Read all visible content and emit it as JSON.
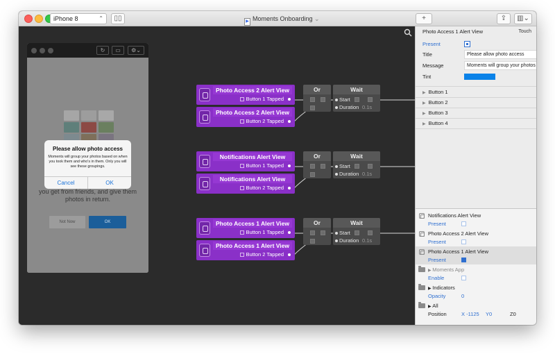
{
  "toolbar": {
    "device": "iPhone 8",
    "document_title": "Moments Onboarding",
    "add_label": "+"
  },
  "preview": {
    "alert": {
      "title": "Please allow photo access",
      "message": "Moments will group your photos based on when you took them and who's in them. Only you will see these groupings.",
      "cancel_label": "Cancel",
      "ok_label": "OK"
    },
    "background_lines": [
      "you get from friends, and give them",
      "photos in return."
    ],
    "not_now_label": "Not Now",
    "ok_label": "OK"
  },
  "canvas": {
    "groups": [
      {
        "blocks": [
          {
            "title": "Photo Access 2 Alert View",
            "port": "Button 1 Tapped"
          },
          {
            "title": "Photo Access 2 Alert View",
            "port": "Button 2 Tapped"
          }
        ],
        "or_label": "Or",
        "wait": {
          "title": "Wait",
          "start_label": "Start",
          "duration_label": "Duration",
          "duration_value": "0.1s"
        }
      },
      {
        "blocks": [
          {
            "title": "Notifications Alert View",
            "port": "Button 1 Tapped"
          },
          {
            "title": "Notifications Alert View",
            "port": "Button 2 Tapped"
          }
        ],
        "or_label": "Or",
        "wait": {
          "title": "Wait",
          "start_label": "Start",
          "duration_label": "Duration",
          "duration_value": "0.1s"
        }
      },
      {
        "blocks": [
          {
            "title": "Photo Access 1 Alert View",
            "port": "Button 1 Tapped"
          },
          {
            "title": "Photo Access 1 Alert View",
            "port": "Button 2 Tapped"
          }
        ],
        "or_label": "Or",
        "wait": {
          "title": "Wait",
          "start_label": "Start",
          "duration_label": "Duration",
          "duration_value": "0.1s"
        }
      }
    ]
  },
  "inspector": {
    "header": "Photo Access 1 Alert View",
    "touch_label": "Touch",
    "present_label": "Present",
    "title_label": "Title",
    "title_value": "Please allow photo access",
    "message_label": "Message",
    "message_value": "Moments will group your photos based on when",
    "tint_label": "Tint",
    "tint_color": "#0a82e8",
    "buttons": [
      "Button 1",
      "Button 2",
      "Button 3",
      "Button 4"
    ]
  },
  "layers": [
    {
      "name": "Notifications Alert View",
      "prop": "Present",
      "checked": false
    },
    {
      "name": "Photo Access 2 Alert View",
      "prop": "Present",
      "checked": false
    },
    {
      "name": "Photo Access 1 Alert View",
      "prop": "Present",
      "checked": true
    },
    {
      "name": "Moments App",
      "prop": "Enable",
      "checked": false
    },
    {
      "name": "Indicators",
      "prop": "Opacity",
      "value": "0"
    },
    {
      "name": "All",
      "prop": "Position",
      "x": "X -1125",
      "y": "Y0",
      "z": "Z0"
    }
  ],
  "colors": {
    "accent_purple": "#8a30c8",
    "accent_blue": "#2f6fd0",
    "canvas_bg": "#2b2b2b"
  }
}
